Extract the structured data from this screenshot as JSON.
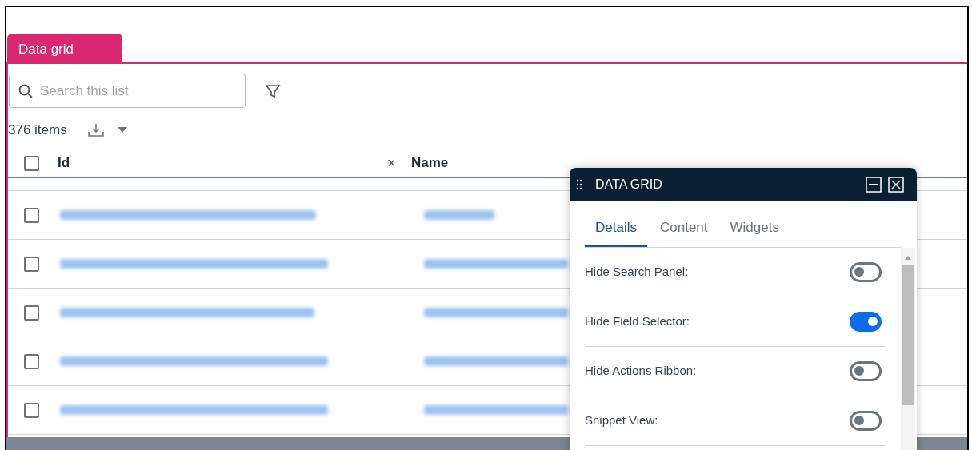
{
  "tabs": [
    {
      "label": "Data grid",
      "selected": true
    }
  ],
  "search": {
    "placeholder": "Search this list"
  },
  "item_count": "376 items",
  "table": {
    "header_checked": false,
    "columns": [
      {
        "label": "Id",
        "close": "×"
      },
      {
        "label": "Name"
      }
    ],
    "rows": [
      {
        "checked": false
      },
      {
        "checked": false
      },
      {
        "checked": false
      },
      {
        "checked": false
      },
      {
        "checked": false
      }
    ]
  },
  "panel": {
    "title": "DATA GRID",
    "tabs": [
      {
        "label": "Details",
        "selected": true
      },
      {
        "label": "Content",
        "selected": false
      },
      {
        "label": "Widgets",
        "selected": false
      }
    ],
    "settings": [
      {
        "label": "Hide Search Panel:",
        "on": false
      },
      {
        "label": "Hide Field Selector:",
        "on": true
      },
      {
        "label": "Hide Actions Ribbon:",
        "on": false
      },
      {
        "label": "Snippet View:",
        "on": false
      }
    ]
  }
}
